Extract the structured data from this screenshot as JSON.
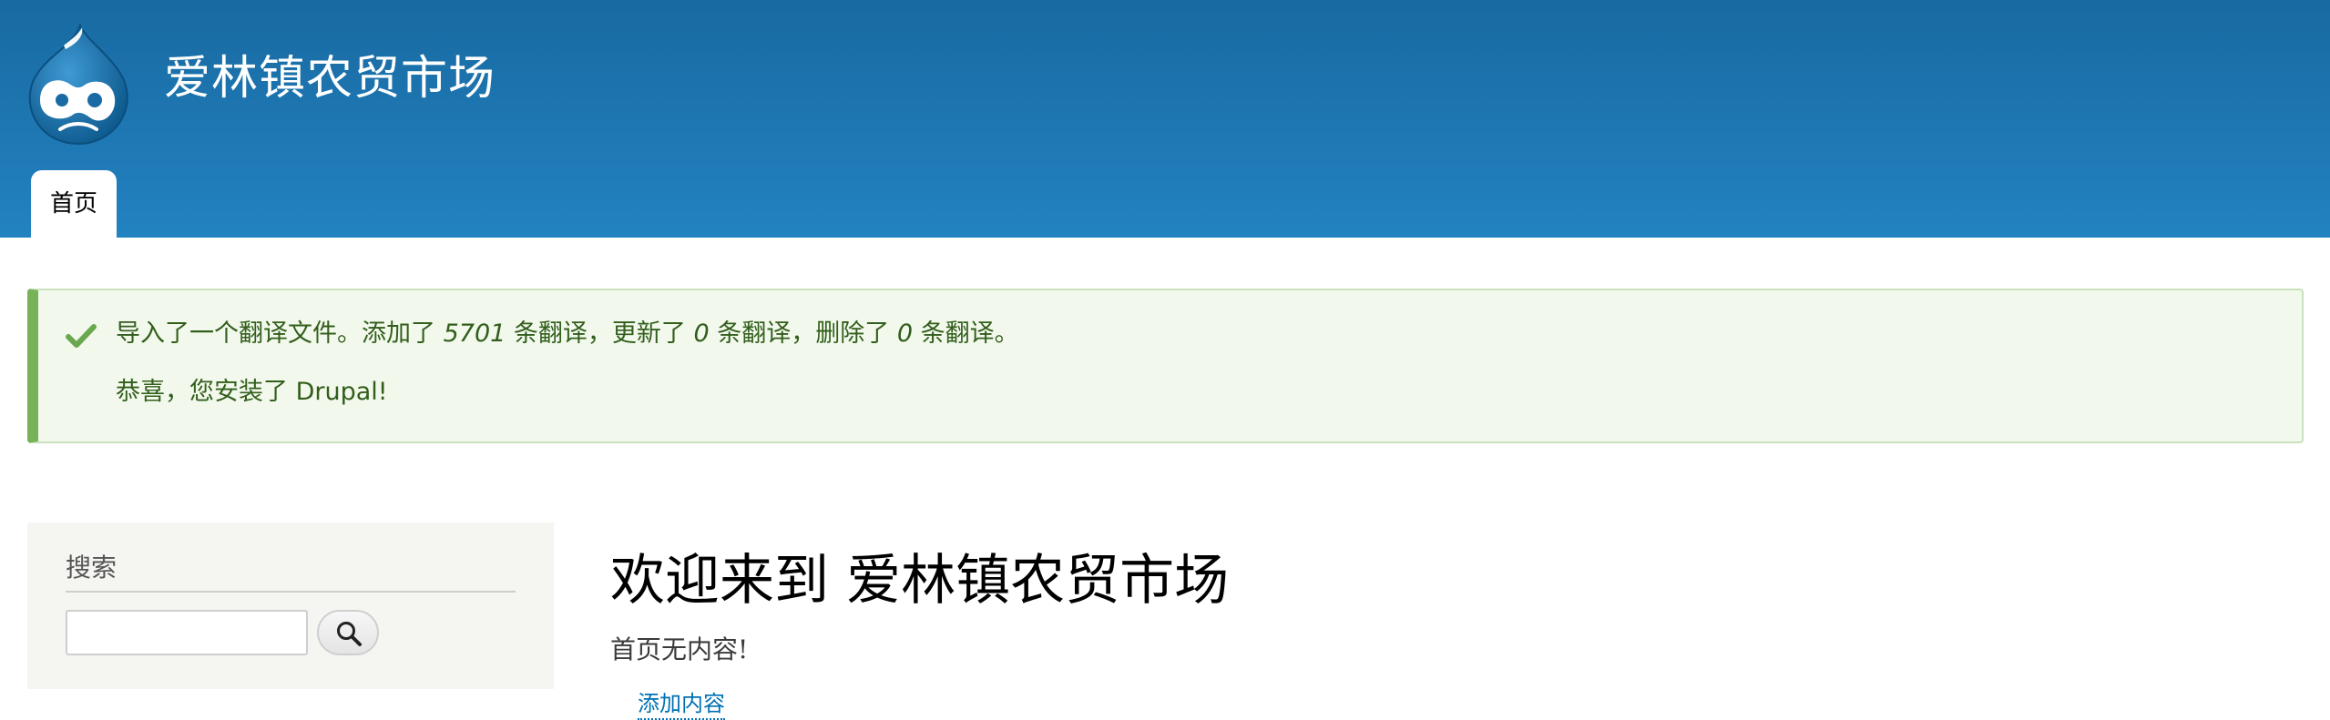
{
  "site": {
    "name": "爱林镇农贸市场",
    "logo_icon": "drupal-drop-logo-icon"
  },
  "nav": {
    "tabs": [
      {
        "label": "首页",
        "active": true
      }
    ]
  },
  "status_message": {
    "icon": "checkmark-icon",
    "line1": {
      "part1": "导入了一个翻译文件。添加了 ",
      "added": "5701",
      "part2": " 条翻译，更新了 ",
      "updated": "0",
      "part3": " 条翻译，删除了 ",
      "deleted": "0",
      "part4": " 条翻译。"
    },
    "line2": "恭喜，您安装了 Drupal!"
  },
  "sidebar": {
    "search_block": {
      "title": "搜索",
      "input_value": "",
      "button_icon": "magnifier-icon"
    }
  },
  "main": {
    "title": "欢迎来到 爱林镇农贸市场",
    "empty_text": "首页无内容!",
    "add_content_link": "添加内容"
  },
  "colors": {
    "header_top": "#186aa1",
    "header_bottom": "#2382c1",
    "status_bg": "#f2f9ec",
    "status_border": "#77b259",
    "status_text": "#325e1c",
    "link": "#0071b3"
  }
}
